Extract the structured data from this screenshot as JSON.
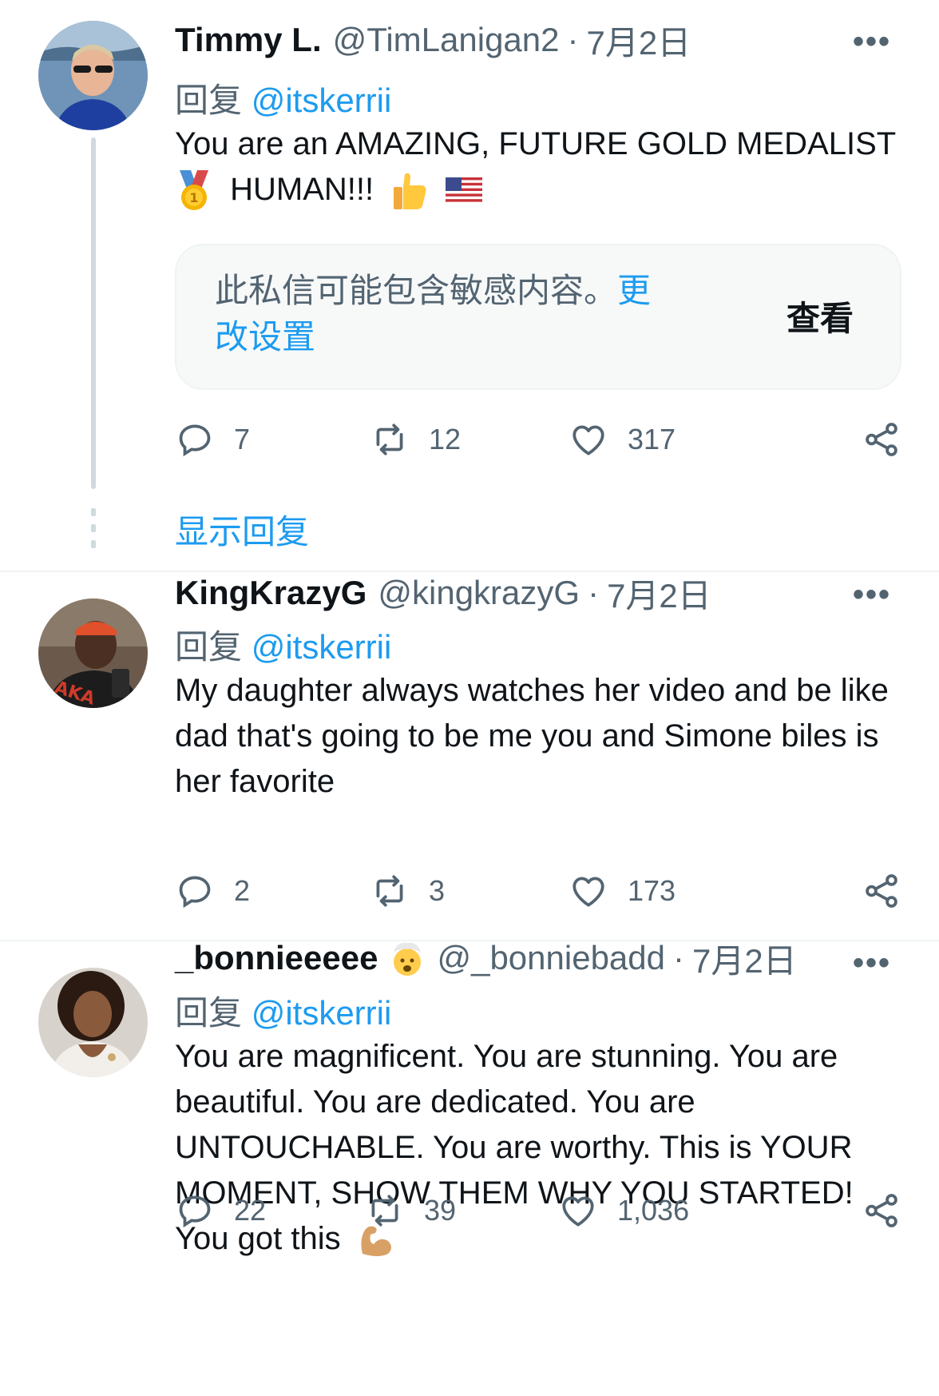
{
  "tweets": [
    {
      "name": "Timmy L.",
      "handle": "@TimLanigan2",
      "separator": "·",
      "date": "7月2日",
      "replying_prefix": "回复",
      "replying_to": "@itskerrii",
      "text_line1": "You are an AMAZING, FUTURE GOLD MEDALIST",
      "text_line2_text": "HUMAN!!!",
      "emojis": [
        "1st-place-medal-icon",
        "thumbs-up-icon",
        "us-flag-icon"
      ],
      "sensitive_notice": {
        "message": "此私信可能包含敏感内容。",
        "link": "更改设置",
        "button": "查看"
      },
      "counts": {
        "replies": "7",
        "retweets": "12",
        "likes": "317"
      },
      "show_replies": "显示回复"
    },
    {
      "name": "KingKrazyG",
      "handle": "@kingkrazyG",
      "separator": "·",
      "date": "7月2日",
      "replying_prefix": "回复",
      "replying_to": "@itskerrii",
      "text": "My daughter always watches her video and be like dad that's going to be me you and Simone biles is her favorite",
      "counts": {
        "replies": "2",
        "retweets": "3",
        "likes": "173"
      }
    },
    {
      "name": "_bonnieeeee",
      "name_emoji": "exploding-head-icon",
      "handle": "@_bonniebadd",
      "separator": "·",
      "date": "7月2日",
      "replying_prefix": "回复",
      "replying_to": "@itskerrii",
      "text": "You are magnificent. You are stunning. You are beautiful. You are dedicated. You are UNTOUCHABLE. You are worthy. This is YOUR MOMENT, SHOW THEM WHY YOU STARTED! You got this",
      "trailing_emoji": "flexed-biceps-icon",
      "counts": {
        "replies": "22",
        "retweets": "39",
        "likes": "1,036"
      }
    }
  ],
  "more_icon": "•••",
  "colors": {
    "link": "#1d9bf0",
    "secondary": "#536471",
    "text": "#0f1419",
    "divider": "#eff3f4"
  }
}
